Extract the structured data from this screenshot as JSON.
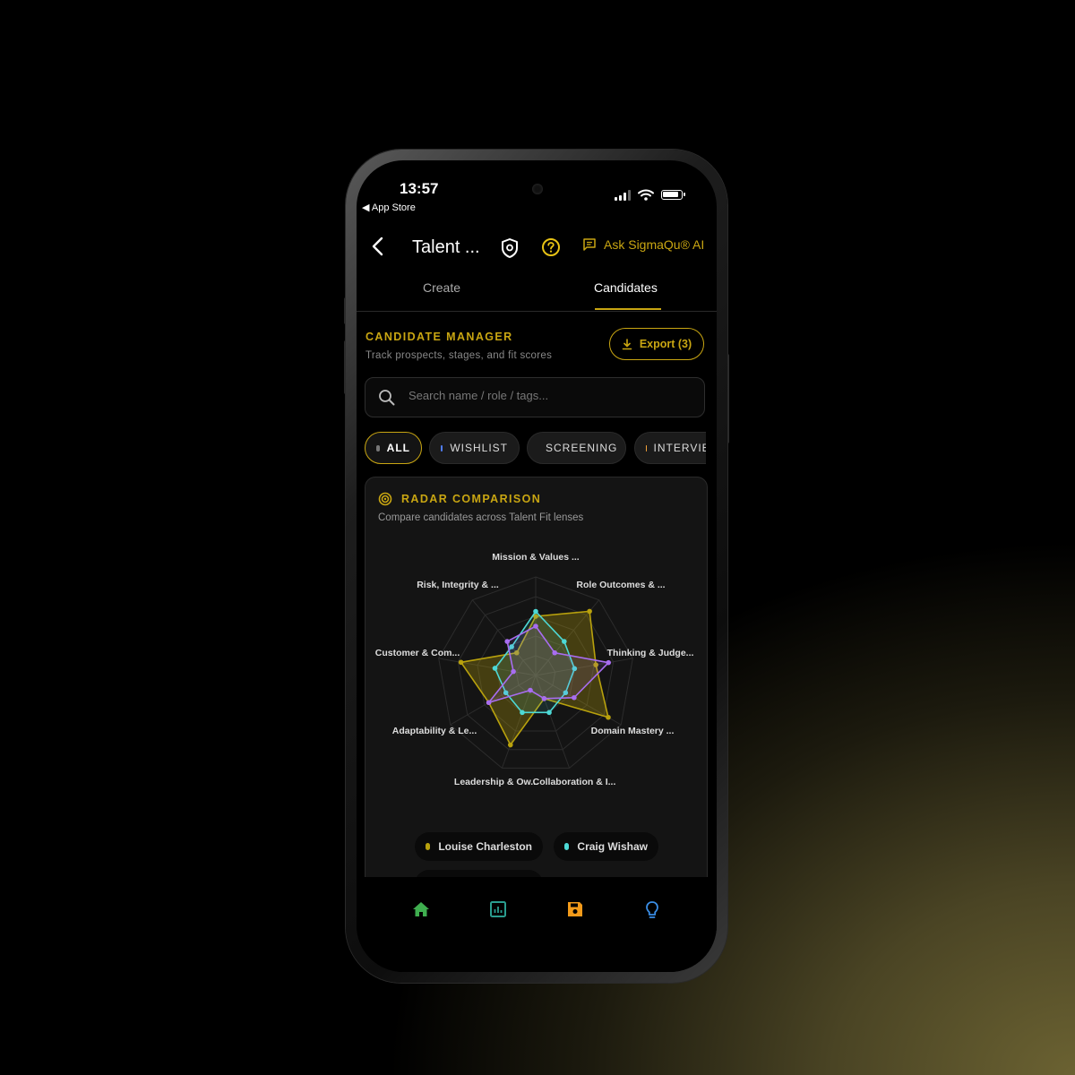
{
  "status": {
    "time": "13:57",
    "back_app": "◀ App Store"
  },
  "appbar": {
    "title": "Talent ...",
    "ask_label": "Ask SigmaQu® AI"
  },
  "tabs": [
    {
      "label": "Create",
      "active": false
    },
    {
      "label": "Candidates",
      "active": true
    }
  ],
  "manager": {
    "title": "CANDIDATE MANAGER",
    "subtitle": "Track prospects, stages, and fit scores",
    "export_label": "Export (3)"
  },
  "search": {
    "placeholder": "Search name / role / tags...",
    "value": ""
  },
  "filters": [
    {
      "label": "ALL",
      "color": "#777777",
      "active": true
    },
    {
      "label": "WISHLIST",
      "color": "#4f7df2",
      "active": false
    },
    {
      "label": "SCREENING",
      "color": "#4dd9d6",
      "active": false
    },
    {
      "label": "INTERVIEW",
      "color": "#f2a23a",
      "active": false
    }
  ],
  "radar_card": {
    "title": "RADAR COMPARISON",
    "subtitle": "Compare candidates across Talent Fit lenses"
  },
  "colors": {
    "accent": "#c9a612",
    "louise": "#b8a10d",
    "craig": "#4dd9d6",
    "purple": "#a86df0"
  },
  "chart_data": {
    "type": "radar",
    "axes": [
      "Mission & Values ...",
      "Role Outcomes & ...",
      "Thinking & Judge...",
      "Domain Mastery ...",
      "Collaboration & I...",
      "Leadership & Ow...",
      "Adaptability & Le...",
      "Customer & Com...",
      "Risk, Integrity & ..."
    ],
    "rmax": 100,
    "rings": 5,
    "series": [
      {
        "name": "Louise Charleston",
        "color": "#b8a10d",
        "values": [
          60,
          85,
          62,
          85,
          25,
          75,
          55,
          77,
          30
        ]
      },
      {
        "name": "Craig Wishaw",
        "color": "#4dd9d6",
        "values": [
          65,
          45,
          40,
          35,
          40,
          40,
          35,
          42,
          38
        ]
      },
      {
        "name": "",
        "color": "#a86df0",
        "values": [
          50,
          30,
          75,
          45,
          25,
          16,
          55,
          23,
          45
        ]
      }
    ]
  },
  "legend": [
    {
      "name": "Louise Charleston",
      "color": "#b8a10d"
    },
    {
      "name": "Craig Wishaw",
      "color": "#4dd9d6"
    }
  ],
  "nav": [
    {
      "icon": "home-icon",
      "color": "#3fae4f"
    },
    {
      "icon": "chart-icon",
      "color": "#2a9d8f"
    },
    {
      "icon": "save-icon",
      "color": "#f29a1a"
    },
    {
      "icon": "lightbulb-icon",
      "color": "#3a8ee6"
    }
  ]
}
